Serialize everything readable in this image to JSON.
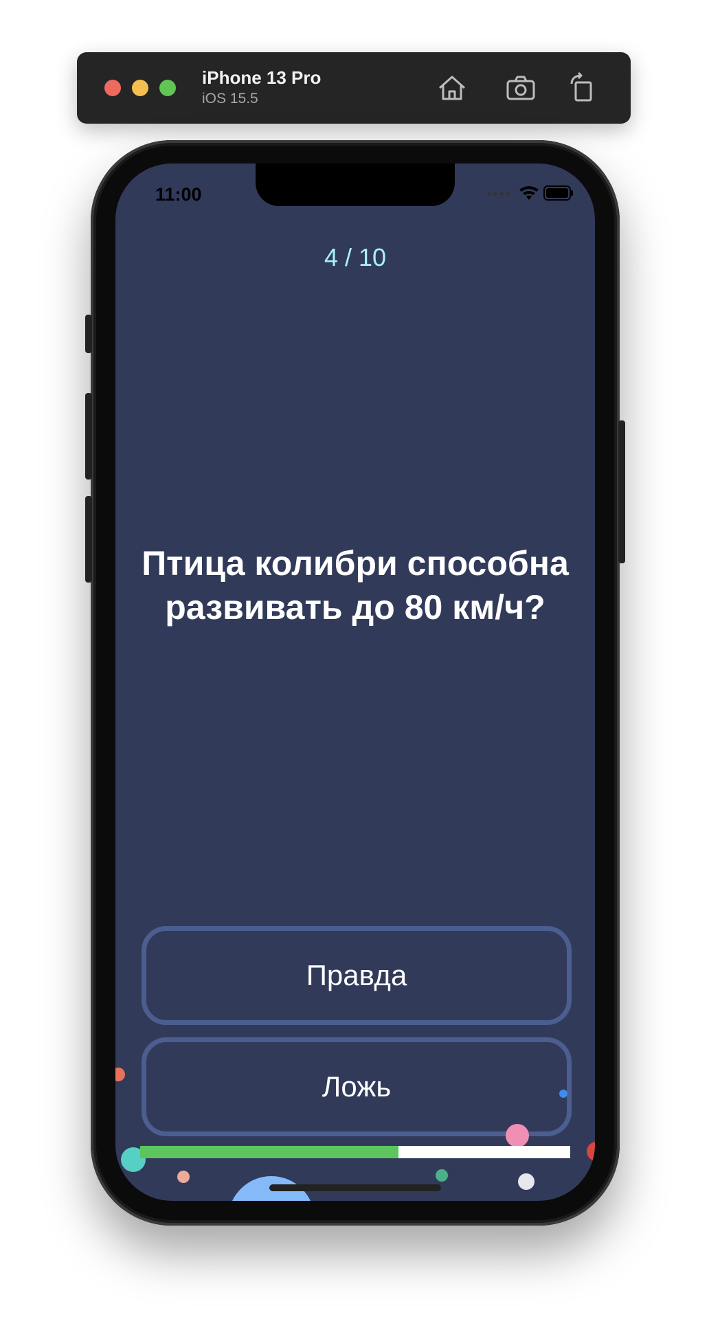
{
  "toolbar": {
    "device_name": "iPhone 13 Pro",
    "os_version": "iOS 15.5",
    "icons": [
      "home-icon",
      "screenshot-icon",
      "rotate-icon"
    ]
  },
  "status_bar": {
    "time": "11:00",
    "icons": [
      "signal-icon",
      "wifi-icon",
      "battery-icon"
    ]
  },
  "quiz": {
    "counter": "4 / 10",
    "question": "Птица колибри способна развивать до 80 км/ч?",
    "answers": {
      "true_label": "Правда",
      "false_label": "Ложь"
    },
    "progress_fraction": 0.6
  },
  "colors": {
    "screen_bg": "#323a5a",
    "counter_text": "#a9f1f4",
    "button_border": "#4c5e8f",
    "progress_fill": "#5cc55d",
    "progress_track": "#ffffff"
  }
}
